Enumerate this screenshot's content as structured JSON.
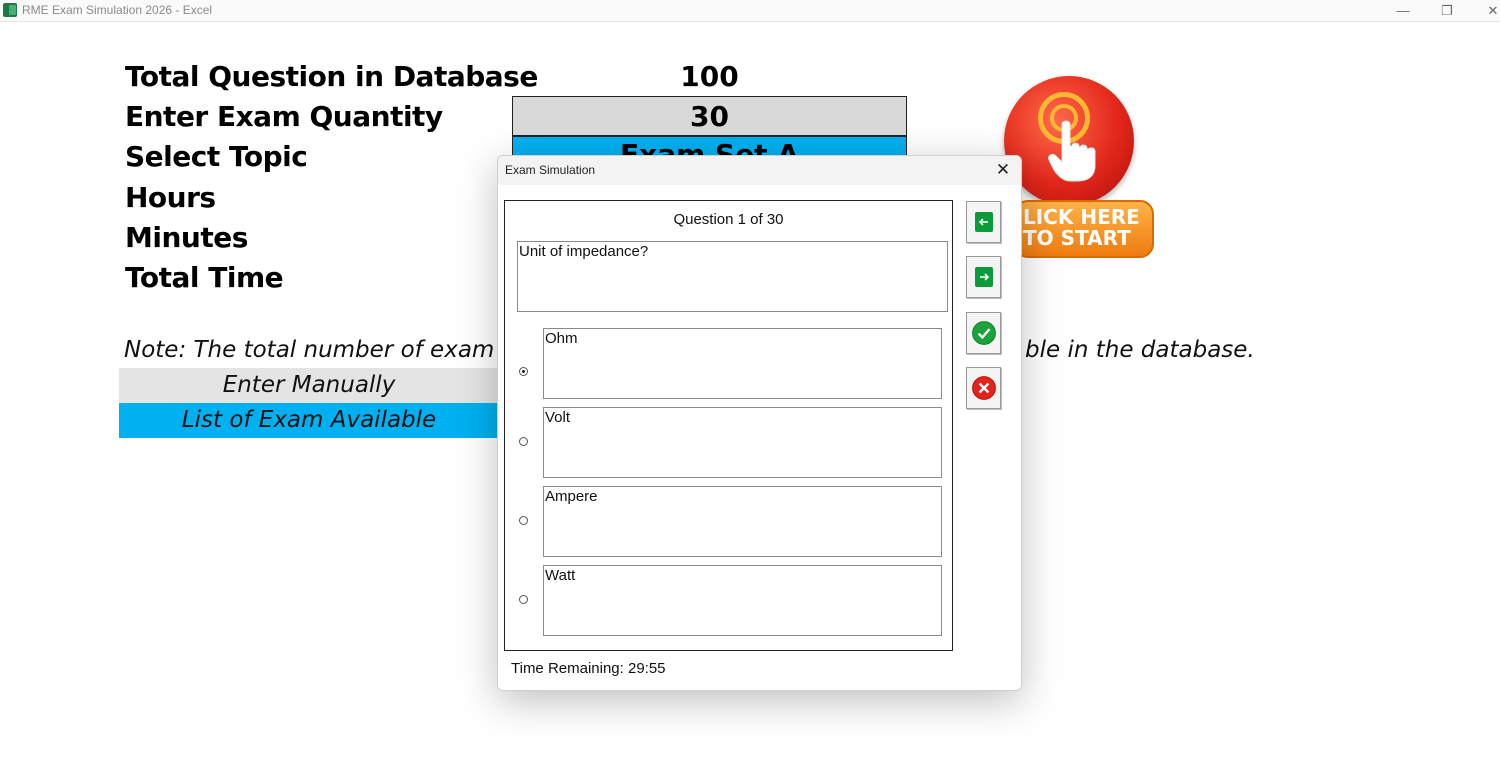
{
  "window": {
    "title": "RME Exam Simulation 2026 - Excel",
    "min": "—",
    "restore": "❐",
    "close": "✕"
  },
  "sheet": {
    "labels": [
      "Total Question in Database",
      "Enter Exam Quantity",
      "Select Topic",
      "Hours",
      "Minutes",
      "Total Time"
    ],
    "total_questions": "100",
    "exam_quantity": "30",
    "topic_partial": "Exam Set A",
    "note_left": "Note: The total number of exam",
    "note_right": "ble in the database.",
    "enter_manually": "Enter Manually",
    "list_exam": "List of Exam Available",
    "start_line1": "LICK HERE",
    "start_line2": "TO START"
  },
  "colors": {
    "band_gray": "#e4e4e4",
    "band_blue": "#00b0f0",
    "quantity_cell": "#d9d9d9"
  },
  "dialog": {
    "title": "Exam Simulation",
    "close": "✕",
    "question_number": "Question 1 of 30",
    "question_text": "Unit of impedance?",
    "options": [
      {
        "label": "Ohm",
        "selected": true
      },
      {
        "label": "Volt",
        "selected": false
      },
      {
        "label": "Ampere",
        "selected": false
      },
      {
        "label": "Watt",
        "selected": false
      }
    ],
    "timer": "Time Remaining: 29:55",
    "buttons": [
      "arrow-left-icon",
      "arrow-right-icon",
      "check-icon",
      "cancel-icon"
    ]
  }
}
